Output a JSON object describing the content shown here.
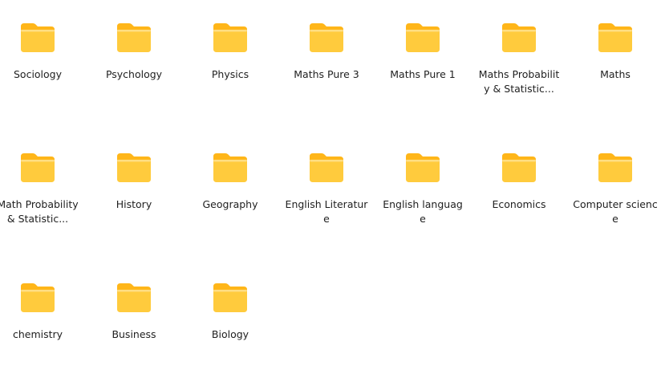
{
  "folders": [
    {
      "label": "Sociology"
    },
    {
      "label": "Psychology"
    },
    {
      "label": "Physics"
    },
    {
      "label": "Maths Pure 3"
    },
    {
      "label": "Maths Pure 1"
    },
    {
      "label": "Maths Probability & Statistic..."
    },
    {
      "label": "Maths"
    },
    {
      "label": "Math Probability & Statistic..."
    },
    {
      "label": "History"
    },
    {
      "label": "Geography"
    },
    {
      "label": "English Literature"
    },
    {
      "label": "English language"
    },
    {
      "label": "Economics"
    },
    {
      "label": "Computer science"
    },
    {
      "label": "chemistry"
    },
    {
      "label": "Business"
    },
    {
      "label": "Biology"
    }
  ],
  "icon": "folder-icon",
  "colors": {
    "folder_front": "#FFCB3D",
    "folder_back": "#FFB619",
    "background": "#FFFFFF",
    "text": "#1F1F1F"
  }
}
